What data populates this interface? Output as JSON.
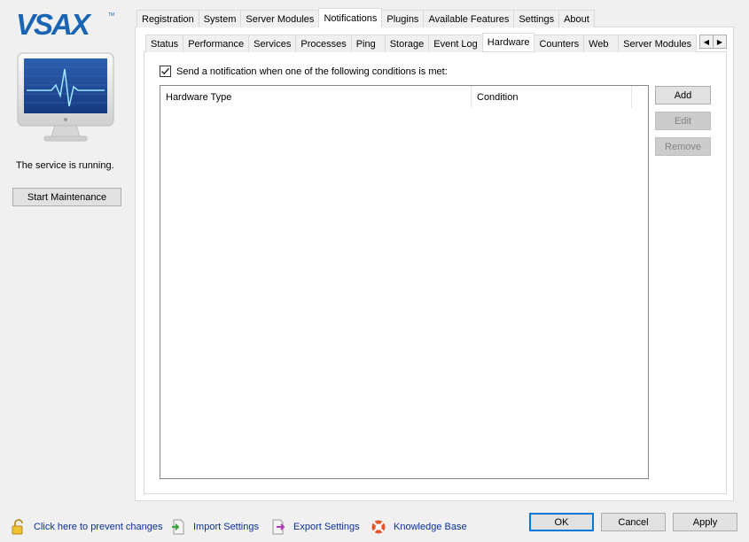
{
  "branding": {
    "logo_text": "VSAX",
    "tm": "TM"
  },
  "service": {
    "status_text": "The service is running.",
    "maintenance_button": "Start Maintenance"
  },
  "main_tabs": [
    "Registration",
    "System",
    "Server Modules",
    "Notifications",
    "Plugins",
    "Available Features",
    "Settings",
    "About"
  ],
  "main_active": "Notifications",
  "sub_tabs": [
    "Status",
    "Performance",
    "Services",
    "Processes",
    "Ping",
    "Storage",
    "Event Log",
    "Hardware",
    "Counters",
    "Web",
    "Server Modules"
  ],
  "sub_active": "Hardware",
  "hardware": {
    "notify_checkbox_label": "Send a notification when one of the following conditions is met:",
    "notify_checked": true,
    "columns": [
      "Hardware Type",
      "Condition"
    ],
    "rows": [],
    "add_label": "Add",
    "edit_label": "Edit",
    "remove_label": "Remove"
  },
  "footer": {
    "prevent_changes": "Click here to prevent changes",
    "import_settings": "Import Settings",
    "export_settings": "Export Settings",
    "knowledge_base": "Knowledge Base",
    "ok": "OK",
    "cancel": "Cancel",
    "apply": "Apply"
  },
  "colors": {
    "logo_blue": "#1a64b4",
    "link_blue": "#0b2f9a",
    "focus_blue": "#0078d7",
    "monitor_screen": "#1c3f8a"
  }
}
